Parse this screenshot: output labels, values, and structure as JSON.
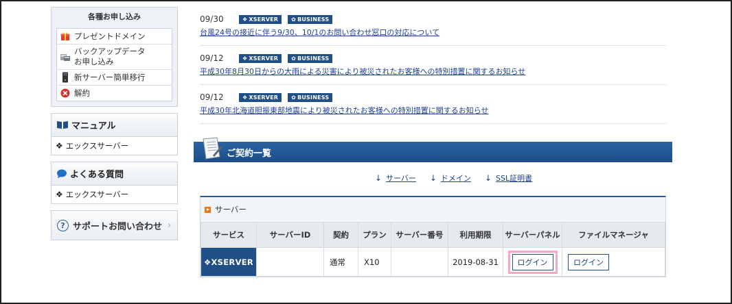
{
  "sidebar": {
    "apply_title": "各種お申し込み",
    "apply_items": [
      {
        "label": "プレゼントドメイン",
        "icon": "gift-icon"
      },
      {
        "label": "バックアップデータ\nお申し込み",
        "icon": "backup-icon"
      },
      {
        "label": "新サーバー簡単移行",
        "icon": "server-migrate-icon"
      },
      {
        "label": "解約",
        "icon": "cancel-icon"
      }
    ],
    "manual_title": "マニュアル",
    "manual_link": "エックスサーバー",
    "faq_title": "よくある質問",
    "faq_link": "エックスサーバー",
    "support_label": "サポートお問い合わせ",
    "support_chevron": "›"
  },
  "news": [
    {
      "date": "09/30",
      "tags": [
        "XSERVER",
        "BUSINESS"
      ],
      "title": "台風24号の接近に伴う9/30、10/1のお問い合わせ窓口の対応について"
    },
    {
      "date": "09/12",
      "tags": [
        "XSERVER",
        "BUSINESS"
      ],
      "title": "平成30年8月30日からの大雨による災害により被災されたお客様への特別措置に関するお知らせ"
    },
    {
      "date": "09/12",
      "tags": [
        "XSERVER",
        "BUSINESS"
      ],
      "title": "平成30年北海道胆振東部地震により被災されたお客様への特別措置に関するお知らせ"
    }
  ],
  "contract": {
    "title": "ご契約一覧",
    "anchors": [
      "サーバー",
      "ドメイン",
      "SSL証明書"
    ],
    "server_section_title": "サーバー",
    "columns": [
      "サービス",
      "サーバーID",
      "契約",
      "プラン",
      "サーバー番号",
      "利用期限",
      "サーバーパネル",
      "ファイルマネージャ"
    ],
    "row": {
      "service": "XSERVER",
      "server_id": "",
      "contract": "通常",
      "plan": "X10",
      "server_number": "",
      "expiry": "2019-08-31",
      "panel_button": "ログイン",
      "filemanager_button": "ログイン"
    }
  },
  "colors": {
    "brand_blue": "#1f4f86",
    "highlight_pink": "#f5a7c7",
    "link_blue": "#1b3f8f"
  }
}
